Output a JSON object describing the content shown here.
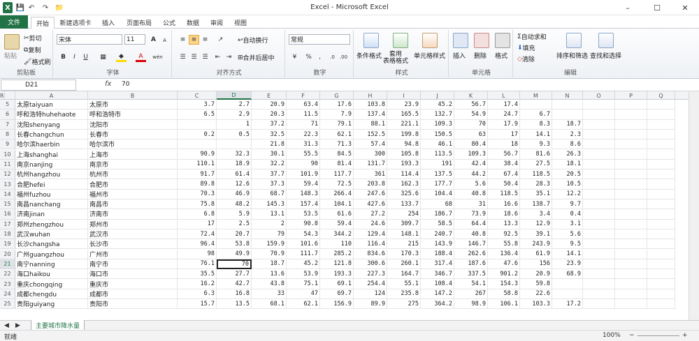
{
  "window": {
    "title": "Excel - Microsoft Excel",
    "minimize": "–",
    "maximize": "☐",
    "close": "✕"
  },
  "quick_access": [
    "X",
    "💾",
    "↶",
    "↷",
    "📁"
  ],
  "tabs": [
    "文件",
    "开始",
    "新建选项卡",
    "插入",
    "页面布局",
    "公式",
    "数据",
    "审阅",
    "视图"
  ],
  "ribbon": {
    "clipboard": {
      "label": "剪贴板",
      "paste": "粘贴",
      "cut": "剪切",
      "copy": "复制",
      "format_painter": "格式刷"
    },
    "font": {
      "label": "字体",
      "name": "宋体",
      "size": "11",
      "bold": "B",
      "italic": "I",
      "underline": "U",
      "grow": "A",
      "shrink": "A",
      "wen": "wén"
    },
    "alignment": {
      "label": "对齐方式",
      "wrap": "自动换行",
      "merge": "合并后居中"
    },
    "number": {
      "label": "数字",
      "format": "常规",
      "percent": "%",
      "comma": ","
    },
    "styles": {
      "label": "样式",
      "conditional": "条件格式",
      "table": "套用\n表格格式",
      "cell": "单元格样式"
    },
    "cells": {
      "label": "单元格",
      "insert": "插入",
      "delete": "删除",
      "format": "格式"
    },
    "editing": {
      "label": "编辑",
      "autosum": "自动求和",
      "fill": "填充",
      "clear": "清除",
      "sort": "排序和筛选",
      "find": "查找和选择"
    }
  },
  "formula_bar": {
    "name_box": "D21",
    "fx": "fx",
    "value": "70"
  },
  "columns": [
    "A",
    "B",
    "C",
    "D",
    "E",
    "F",
    "G",
    "H",
    "I",
    "J",
    "K",
    "L",
    "M",
    "N",
    "O",
    "P",
    "Q",
    "R"
  ],
  "active_col": "D",
  "active_row": "21",
  "rows": [
    {
      "n": "5",
      "a": "太原taiyuan",
      "b": "太原市",
      "v": [
        "3.7",
        "2.7",
        "20.9",
        "63.4",
        "17.6",
        "103.8",
        "23.9",
        "45.2",
        "56.7",
        "17.4",
        "",
        ""
      ]
    },
    {
      "n": "6",
      "a": "呼和浩特huhehaote",
      "b": "呼和浩特市",
      "v": [
        "6.5",
        "2.9",
        "20.3",
        "11.5",
        "7.9",
        "137.4",
        "165.5",
        "132.7",
        "54.9",
        "24.7",
        "6.7",
        ""
      ]
    },
    {
      "n": "7",
      "a": "沈阳shenyang",
      "b": "沈阳市",
      "v": [
        "",
        "1",
        "37.2",
        "71",
        "79.1",
        "88.1",
        "221.1",
        "109.3",
        "70",
        "17.9",
        "8.3",
        "18.7"
      ]
    },
    {
      "n": "8",
      "a": "长春changchun",
      "b": "长春市",
      "v": [
        "0.2",
        "0.5",
        "32.5",
        "22.3",
        "62.1",
        "152.5",
        "199.8",
        "150.5",
        "63",
        "17",
        "14.1",
        "2.3"
      ]
    },
    {
      "n": "9",
      "a": "哈尔滨haerbin",
      "b": "哈尔滨市",
      "v": [
        "",
        "",
        "21.8",
        "31.3",
        "71.3",
        "57.4",
        "94.8",
        "46.1",
        "80.4",
        "18",
        "9.3",
        "8.6"
      ]
    },
    {
      "n": "10",
      "a": "上海shanghai",
      "b": "上海市",
      "v": [
        "90.9",
        "32.3",
        "30.1",
        "55.5",
        "84.5",
        "300",
        "105.8",
        "113.5",
        "109.3",
        "56.7",
        "81.6",
        "26.3"
      ]
    },
    {
      "n": "11",
      "a": "南京nanjing",
      "b": "南京市",
      "v": [
        "110.1",
        "18.9",
        "32.2",
        "90",
        "81.4",
        "131.7",
        "193.3",
        "191",
        "42.4",
        "38.4",
        "27.5",
        "18.1"
      ]
    },
    {
      "n": "12",
      "a": "杭州hangzhou",
      "b": "杭州市",
      "v": [
        "91.7",
        "61.4",
        "37.7",
        "101.9",
        "117.7",
        "361",
        "114.4",
        "137.5",
        "44.2",
        "67.4",
        "118.5",
        "20.5"
      ]
    },
    {
      "n": "13",
      "a": "合肥hefei",
      "b": "合肥市",
      "v": [
        "89.8",
        "12.6",
        "37.3",
        "59.4",
        "72.5",
        "203.8",
        "162.3",
        "177.7",
        "5.6",
        "50.4",
        "28.3",
        "10.5"
      ]
    },
    {
      "n": "14",
      "a": "福州fuzhou",
      "b": "福州市",
      "v": [
        "70.3",
        "46.9",
        "68.7",
        "148.3",
        "266.4",
        "247.6",
        "325.6",
        "104.4",
        "40.8",
        "118.5",
        "35.1",
        "12.2"
      ]
    },
    {
      "n": "15",
      "a": "南昌nanchang",
      "b": "南昌市",
      "v": [
        "75.8",
        "48.2",
        "145.3",
        "157.4",
        "104.1",
        "427.6",
        "133.7",
        "68",
        "31",
        "16.6",
        "138.7",
        "9.7"
      ]
    },
    {
      "n": "16",
      "a": "济南jinan",
      "b": "济南市",
      "v": [
        "6.8",
        "5.9",
        "13.1",
        "53.5",
        "61.6",
        "27.2",
        "254",
        "186.7",
        "73.9",
        "18.6",
        "3.4",
        "0.4"
      ]
    },
    {
      "n": "17",
      "a": "郑州zhengzhou",
      "b": "郑州市",
      "v": [
        "17",
        "2.5",
        "2",
        "90.8",
        "59.4",
        "24.6",
        "309.7",
        "58.5",
        "64.4",
        "13.3",
        "12.9",
        "3.1"
      ]
    },
    {
      "n": "18",
      "a": "武汉wuhan",
      "b": "武汉市",
      "v": [
        "72.4",
        "20.7",
        "79",
        "54.3",
        "344.2",
        "129.4",
        "148.1",
        "240.7",
        "40.8",
        "92.5",
        "39.1",
        "5.6"
      ]
    },
    {
      "n": "19",
      "a": "长沙changsha",
      "b": "长沙市",
      "v": [
        "96.4",
        "53.8",
        "159.9",
        "101.6",
        "110",
        "116.4",
        "215",
        "143.9",
        "146.7",
        "55.8",
        "243.9",
        "9.5"
      ]
    },
    {
      "n": "20",
      "a": "广州guangzhou",
      "b": "广州市",
      "v": [
        "98",
        "49.9",
        "70.9",
        "111.7",
        "285.2",
        "834.6",
        "170.3",
        "188.4",
        "262.6",
        "136.4",
        "61.9",
        "14.1"
      ]
    },
    {
      "n": "21",
      "a": "南宁nanning",
      "b": "南宁市",
      "v": [
        "76.1",
        "70",
        "18.7",
        "45.2",
        "121.8",
        "300.6",
        "260.1",
        "317.4",
        "187.6",
        "47.6",
        "156",
        "23.9"
      ]
    },
    {
      "n": "22",
      "a": "海口haikou",
      "b": "海口市",
      "v": [
        "35.5",
        "27.7",
        "13.6",
        "53.9",
        "193.3",
        "227.3",
        "164.7",
        "346.7",
        "337.5",
        "901.2",
        "20.9",
        "68.9"
      ]
    },
    {
      "n": "23",
      "a": "重庆chongqing",
      "b": "重庆市",
      "v": [
        "16.2",
        "42.7",
        "43.8",
        "75.1",
        "69.1",
        "254.4",
        "55.1",
        "108.4",
        "54.1",
        "154.3",
        "59.8",
        ""
      ]
    },
    {
      "n": "24",
      "a": "成都chengdu",
      "b": "成都市",
      "v": [
        "6.3",
        "16.8",
        "33",
        "47",
        "69.7",
        "124",
        "235.8",
        "147.2",
        "267",
        "58.8",
        "22.6",
        ""
      ]
    },
    {
      "n": "25",
      "a": "贵阳guiyang",
      "b": "贵阳市",
      "v": [
        "15.7",
        "13.5",
        "68.1",
        "62.1",
        "156.9",
        "89.9",
        "275",
        "364.2",
        "98.9",
        "106.1",
        "103.3",
        "17.2"
      ]
    }
  ],
  "sheet_tab": "主要城市降水量",
  "status": {
    "ready": "就绪",
    "zoom": "100%",
    "zoom_minus": "−",
    "zoom_plus": "+"
  }
}
